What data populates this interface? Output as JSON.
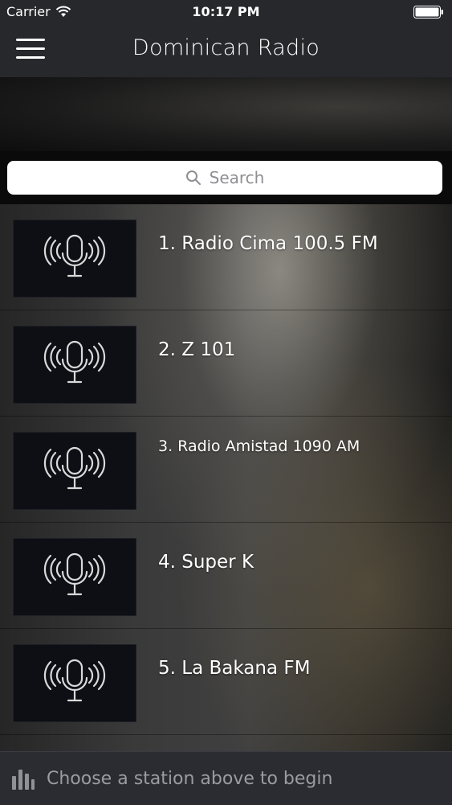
{
  "status_bar": {
    "carrier": "Carrier",
    "time": "10:17 PM"
  },
  "nav": {
    "title": "Dominican Radio",
    "menu_icon": "hamburger-menu-icon"
  },
  "search": {
    "placeholder": "Search"
  },
  "stations": [
    {
      "label": "1. Radio Cima 100.5 FM",
      "icon": "microphone-broadcast-icon"
    },
    {
      "label": "2. Z 101",
      "icon": "microphone-broadcast-icon"
    },
    {
      "label": "3. Radio Amistad 1090 AM",
      "icon": "microphone-broadcast-icon"
    },
    {
      "label": "4. Super K",
      "icon": "microphone-broadcast-icon"
    },
    {
      "label": "5. La Bakana FM",
      "icon": "microphone-broadcast-icon"
    }
  ],
  "player": {
    "message": "Choose a station above to begin",
    "icon": "equalizer-icon"
  }
}
